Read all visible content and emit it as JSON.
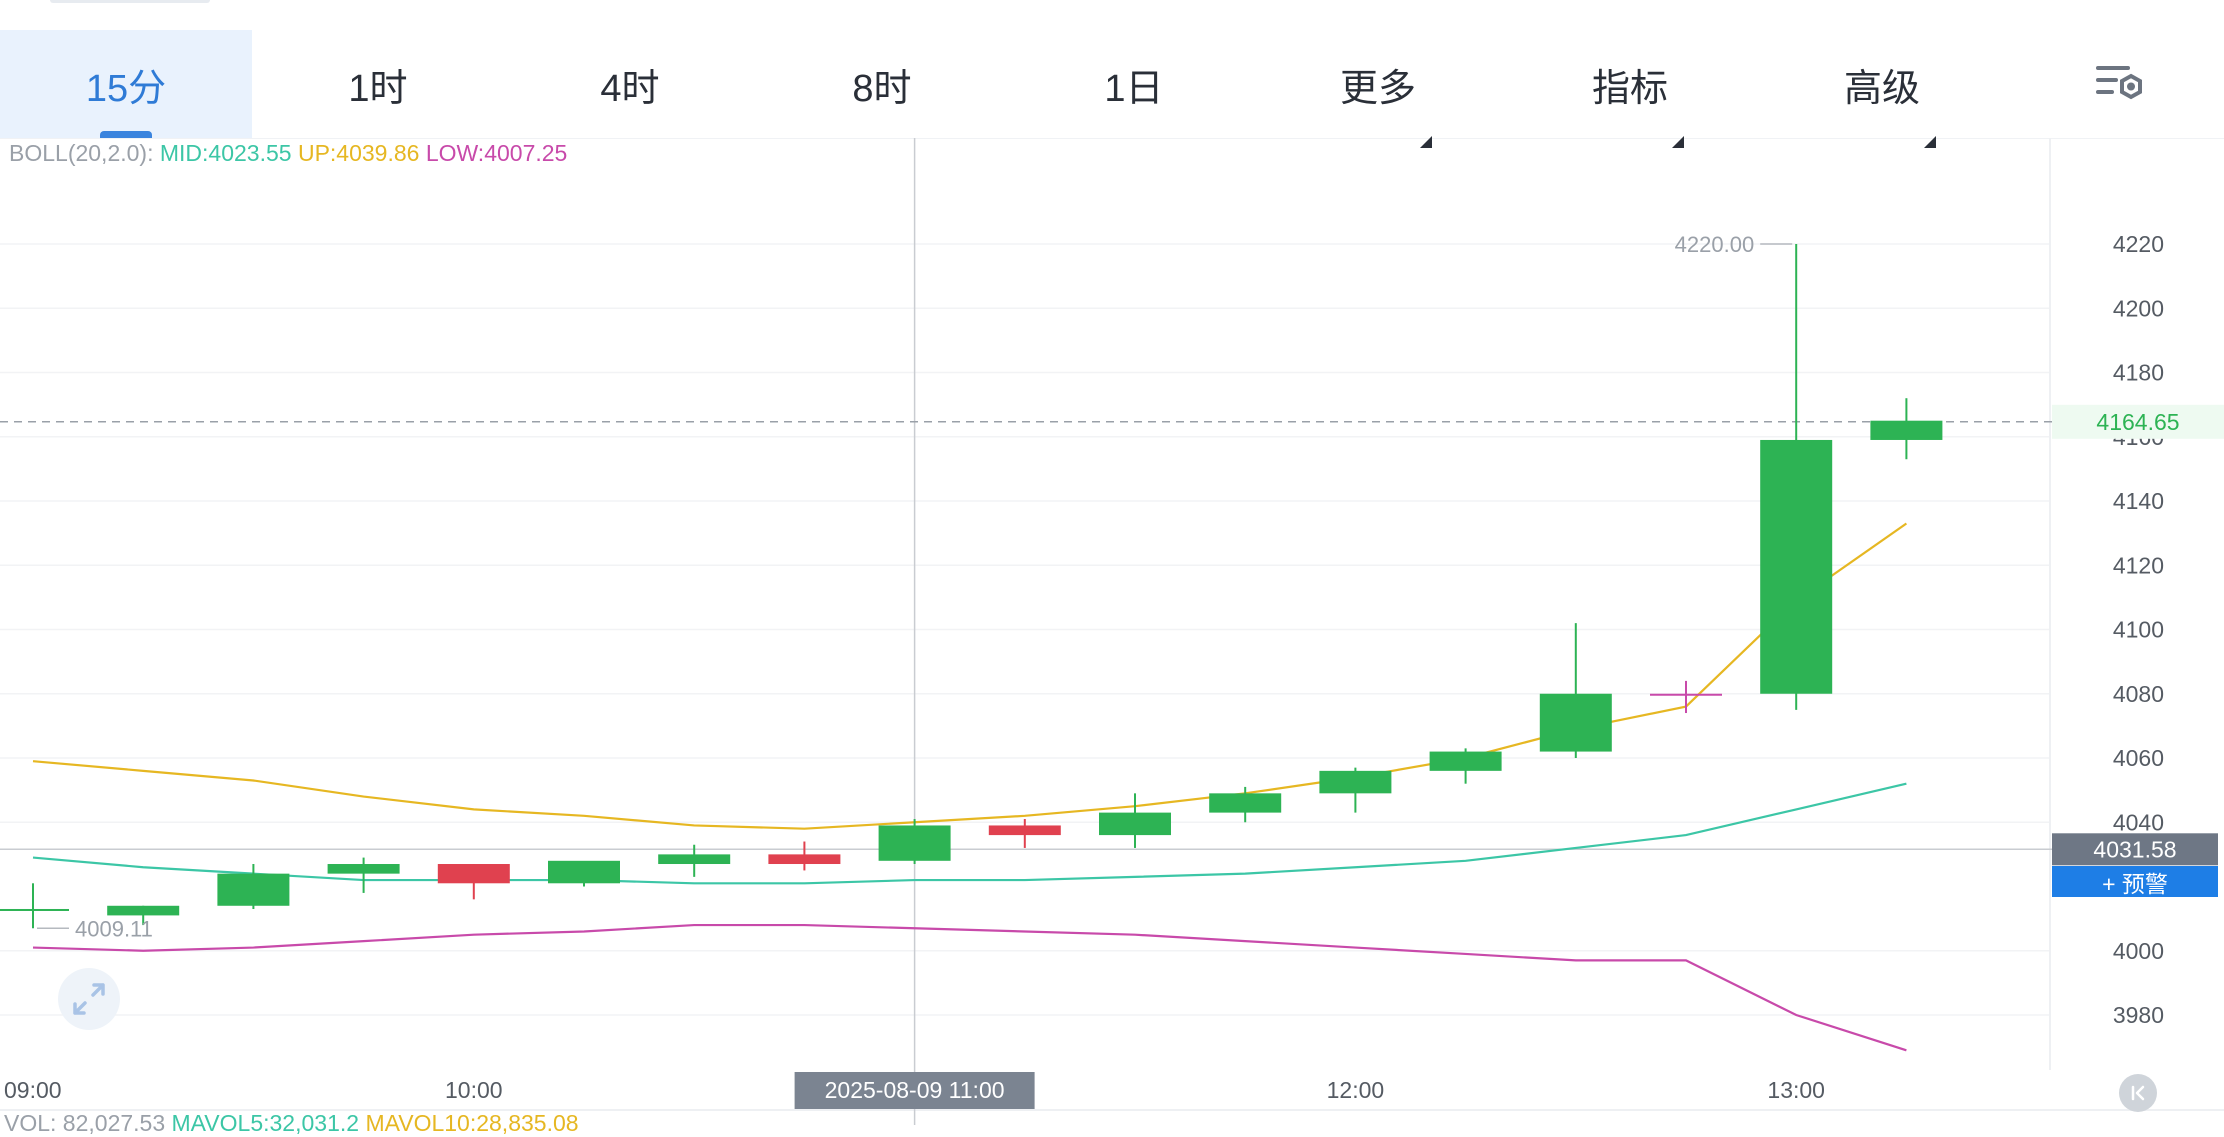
{
  "tabs": [
    {
      "label": "15分",
      "active": true
    },
    {
      "label": "1时"
    },
    {
      "label": "4时"
    },
    {
      "label": "8时"
    },
    {
      "label": "1日"
    },
    {
      "label": "更多",
      "dropdown": true
    },
    {
      "label": "指标",
      "dropdown": true
    },
    {
      "label": "高级",
      "dropdown": true
    }
  ],
  "settings_icon": "chart-settings-icon",
  "boll": {
    "prefix": "BOLL(20,2.0):",
    "mid_label": "MID:",
    "mid": "4023.55",
    "up_label": "UP:",
    "up": "4039.86",
    "low_label": "LOW:",
    "low": "4007.25"
  },
  "vol": {
    "prefix": "VOL: 82,027.53",
    "mavol5": "MAVOL5:32,031.2",
    "mavol10": "MAVOL10:28,835.08"
  },
  "colors": {
    "up": "#2db354",
    "down": "#e0414f",
    "mid": "#3cc6a6",
    "upper": "#e6b722",
    "lower": "#c84aaa",
    "accent": "#1e7ee6"
  },
  "price_readouts": {
    "last_price": "4164.65",
    "crosshair_price": "4031.58",
    "crosshair_time": "2025-08-09 11:00",
    "max_label": "4220.00",
    "min_label": "4009.11",
    "alert_button": "+ 预警"
  },
  "icons": {
    "expand": "expand-icon",
    "back": "scroll-to-latest-icon"
  },
  "chart_data": {
    "type": "candlestick",
    "x_labels": [
      "09:00",
      "10:00",
      "12:00",
      "13:00"
    ],
    "y_ticks": [
      4220,
      4200,
      4180,
      4160,
      4140,
      4120,
      4100,
      4080,
      4060,
      4040,
      4000,
      3980
    ],
    "ylim": [
      3964,
      4242
    ],
    "interval": "15分",
    "candles": [
      {
        "time": "09:00",
        "open": 4013,
        "high": 4021,
        "low": 4007,
        "close": 4013
      },
      {
        "time": "09:15",
        "open": 4011,
        "high": 4014,
        "low": 4008,
        "close": 4014
      },
      {
        "time": "09:30",
        "open": 4014,
        "high": 4027,
        "low": 4013,
        "close": 4024
      },
      {
        "time": "09:45",
        "open": 4024,
        "high": 4029,
        "low": 4018,
        "close": 4027
      },
      {
        "time": "10:00",
        "open": 4027,
        "high": 4027,
        "low": 4016,
        "close": 4021
      },
      {
        "time": "10:15",
        "open": 4021,
        "high": 4026,
        "low": 4020,
        "close": 4028
      },
      {
        "time": "10:30",
        "open": 4027,
        "high": 4033,
        "low": 4023,
        "close": 4030
      },
      {
        "time": "10:45",
        "open": 4030,
        "high": 4034,
        "low": 4025,
        "close": 4027
      },
      {
        "time": "11:00",
        "open": 4028,
        "high": 4041,
        "low": 4027,
        "close": 4039
      },
      {
        "time": "11:15",
        "open": 4039,
        "high": 4041,
        "low": 4032,
        "close": 4036
      },
      {
        "time": "11:30",
        "open": 4036,
        "high": 4049,
        "low": 4032,
        "close": 4043
      },
      {
        "time": "11:45",
        "open": 4043,
        "high": 4051,
        "low": 4040,
        "close": 4049
      },
      {
        "time": "12:00",
        "open": 4049,
        "high": 4057,
        "low": 4043,
        "close": 4056
      },
      {
        "time": "12:15",
        "open": 4056,
        "high": 4063,
        "low": 4052,
        "close": 4062
      },
      {
        "time": "12:30",
        "open": 4062,
        "high": 4102,
        "low": 4060,
        "close": 4080
      },
      {
        "time": "12:45",
        "open": 4080,
        "high": 4084,
        "low": 4074,
        "close": 4080
      },
      {
        "time": "13:00",
        "open": 4080,
        "high": 4220,
        "low": 4075,
        "close": 4159
      },
      {
        "time": "13:15",
        "open": 4159,
        "high": 4172,
        "low": 4153,
        "close": 4165
      }
    ],
    "boll_upper": [
      4059,
      4056,
      4053,
      4048,
      4044,
      4042,
      4039,
      4038,
      4040,
      4042,
      4045,
      4049,
      4054,
      4060,
      4069,
      4076,
      4109,
      4133
    ],
    "boll_mid": [
      4029,
      4026,
      4024,
      4022,
      4022,
      4022,
      4021,
      4021,
      4022,
      4022,
      4023,
      4024,
      4026,
      4028,
      4032,
      4036,
      4044,
      4052
    ],
    "boll_lower": [
      4001,
      4000,
      4001,
      4003,
      4005,
      4006,
      4008,
      4008,
      4007,
      4006,
      4005,
      4003,
      4001,
      3999,
      3997,
      3997,
      3980,
      3969
    ],
    "last_price": 4164.65,
    "crosshair": {
      "time": "11:00",
      "price": 4031.58
    }
  }
}
